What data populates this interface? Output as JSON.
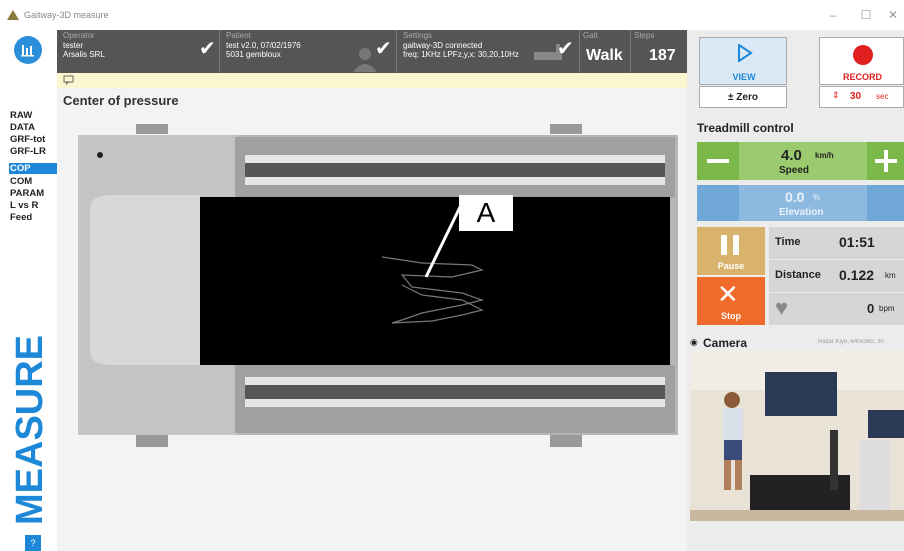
{
  "window": {
    "title": "Gaitway-3D measure",
    "minimize": "–",
    "maximize": "☐",
    "close": "✕"
  },
  "nav": {
    "items": [
      "RAW",
      "DATA",
      "GRF-tot",
      "GRF-LR",
      "COP",
      "COM",
      "PARAM",
      "L vs R",
      "Feed"
    ],
    "selected": "COP"
  },
  "sidebar": {
    "mode": "MEASURE",
    "help": "?"
  },
  "topbar": {
    "operator": {
      "label": "Operator",
      "line1": "tester",
      "line2": "Arsalis SRL"
    },
    "patient": {
      "label": "Patient",
      "line1": "test v2.0, 07/02/1976",
      "line2": "5031 gembloux"
    },
    "settings": {
      "label": "Settings",
      "line1": "gaitway-3D connected",
      "line2": "freq: 1KHz  LPFz,y,x: 30,20,10Hz"
    },
    "gait": {
      "label": "Gait",
      "value": "Walk"
    },
    "steps": {
      "label": "Steps",
      "value": "187"
    }
  },
  "main": {
    "title": "Center of pressure",
    "annotation": "A"
  },
  "controls": {
    "view": {
      "label": "VIEW",
      "zero": "± Zero"
    },
    "record": {
      "label": "RECORD",
      "duration": "30",
      "unit": "sec"
    }
  },
  "treadmill": {
    "title": "Treadmill control",
    "speed": {
      "value": "4.0",
      "unit": "km/h",
      "label": "Speed"
    },
    "elevation": {
      "value": "0.0",
      "unit": "%",
      "label": "Elevation"
    },
    "pause": "Pause",
    "stop": "Stop",
    "time": {
      "label": "Time",
      "value": "01:51"
    },
    "distance": {
      "label": "Distance",
      "value": "0.122",
      "unit": "km"
    },
    "heart": {
      "value": "0",
      "unit": "bpm"
    }
  },
  "camera": {
    "title": "Camera",
    "info": "Razer Kiyo, 640x360, 30"
  },
  "colors": {
    "accent": "#1e88d8",
    "green": "#7ab84a",
    "blue": "#6fa8d8",
    "orange": "#f06a2a",
    "record": "#e02020"
  }
}
